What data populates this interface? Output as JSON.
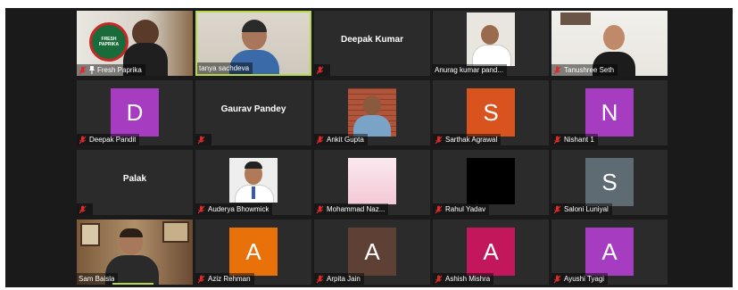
{
  "participants": [
    {
      "name": "Fresh Paprika",
      "logo_text": "FRESH PAPRIKA"
    },
    {
      "name": "tanya sachdeva"
    },
    {
      "name": "Deepak Kumar",
      "center_name": "Deepak Kumar"
    },
    {
      "name": "Anurag kumar pand..."
    },
    {
      "name": "Tanushree Seth"
    },
    {
      "name": "Deepak Pandit",
      "initial": "D",
      "color": "#a63cbf"
    },
    {
      "name": "Gaurav Pandey",
      "center_name": "Gaurav Pandey"
    },
    {
      "name": "Ankit Gupta"
    },
    {
      "name": "Sarthak Agrawal",
      "initial": "S",
      "color": "#d9531e"
    },
    {
      "name": "Nishant 1",
      "initial": "N",
      "color": "#a63cbf"
    },
    {
      "name": "Palak",
      "center_name": "Palak"
    },
    {
      "name": "Auderya Bhowmick"
    },
    {
      "name": "Mohammad Naz..."
    },
    {
      "name": "Rahul Yadav"
    },
    {
      "name": "Saloni Luniyal",
      "initial": "S",
      "color": "#5f6b73"
    },
    {
      "name": "Sam Baisla"
    },
    {
      "name": "Aziz Rehman",
      "initial": "A",
      "color": "#e8710a"
    },
    {
      "name": "Arpita Jain",
      "initial": "A",
      "color": "#5e4035"
    },
    {
      "name": "Ashish Mishra",
      "initial": "A",
      "color": "#c2185b"
    },
    {
      "name": "Ayushi Tyagi",
      "initial": "A",
      "color": "#a63cbf"
    }
  ],
  "colors": {
    "active_speaker_border": "#b5d94a",
    "tile_background": "#2b2b2b",
    "mute_icon": "#e02828"
  },
  "icons": [
    "microphone-muted-icon",
    "pin-icon"
  ]
}
